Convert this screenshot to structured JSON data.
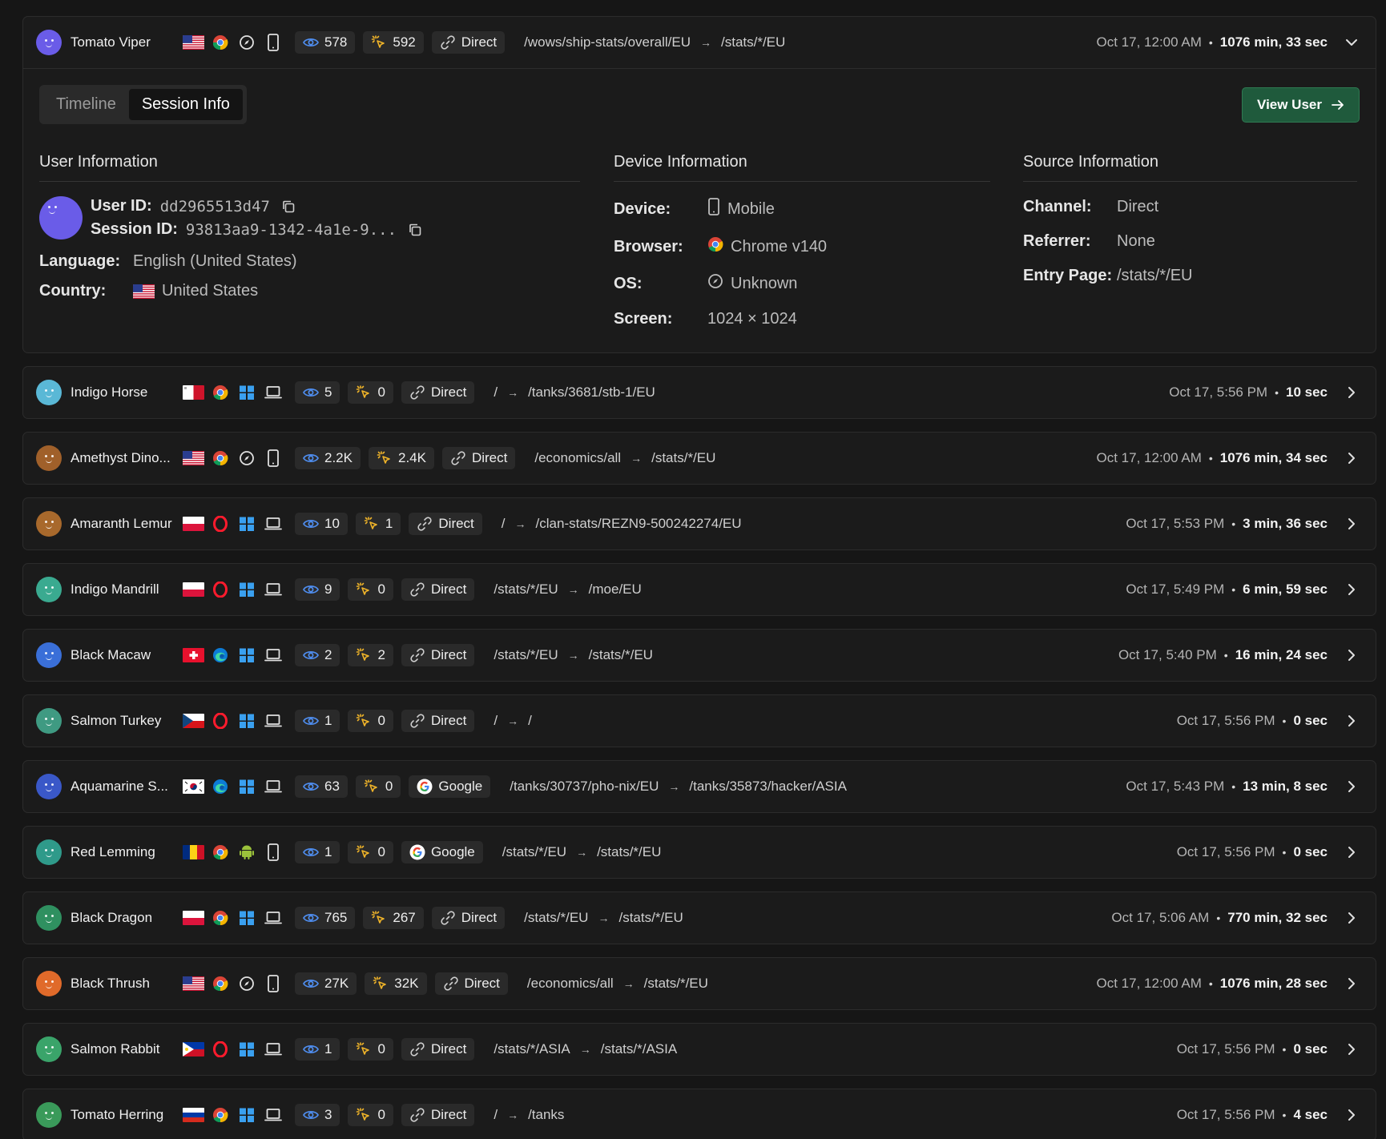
{
  "expanded_session": {
    "user_name": "Tomato Viper",
    "views": "578",
    "events": "592",
    "channel": "Direct",
    "entry_path": "/wows/ship-stats/overall/EU",
    "exit_path": "/stats/*/EU",
    "time": "Oct 17, 12:00 AM",
    "duration": "1076 min, 33 sec",
    "tabs": [
      "Timeline",
      "Session Info"
    ],
    "active_tab": "Session Info",
    "view_user_label": "View User",
    "user_info": {
      "title": "User Information",
      "user_id_label": "User ID:",
      "user_id": "dd2965513d47",
      "session_id_label": "Session ID:",
      "session_id": "93813aa9-1342-4a1e-9...",
      "language_label": "Language:",
      "language": "English (United States)",
      "country_label": "Country:",
      "country": "United States"
    },
    "device_info": {
      "title": "Device Information",
      "device_label": "Device:",
      "device": "Mobile",
      "browser_label": "Browser:",
      "browser": "Chrome v140",
      "os_label": "OS:",
      "os": "Unknown",
      "screen_label": "Screen:",
      "screen": "1024 × 1024"
    },
    "source_info": {
      "title": "Source Information",
      "channel_label": "Channel:",
      "channel": "Direct",
      "referrer_label": "Referrer:",
      "referrer": "None",
      "entry_label": "Entry Page:",
      "entry": "/stats/*/EU"
    }
  },
  "sessions": [
    {
      "name": "Indigo Horse",
      "flag": "mt",
      "browser": "chrome",
      "os": "windows",
      "device": "laptop",
      "views": "5",
      "events": "0",
      "channel": "Direct",
      "channel_icon": "link",
      "entry": "/",
      "exit": "/tanks/3681/stb-1/EU",
      "time": "Oct 17, 5:56 PM",
      "duration": "10 sec",
      "color": "#5ab8d6"
    },
    {
      "name": "Amethyst Dino...",
      "flag": "us",
      "browser": "chrome",
      "os": "unknown",
      "device": "mobile",
      "views": "2.2K",
      "events": "2.4K",
      "channel": "Direct",
      "channel_icon": "link",
      "entry": "/economics/all",
      "exit": "/stats/*/EU",
      "time": "Oct 17, 12:00 AM",
      "duration": "1076 min, 34 sec",
      "color": "#a0602a"
    },
    {
      "name": "Amaranth Lemur",
      "flag": "pl",
      "browser": "opera",
      "os": "windows",
      "device": "laptop",
      "views": "10",
      "events": "1",
      "channel": "Direct",
      "channel_icon": "link",
      "entry": "/",
      "exit": "/clan-stats/REZN9-500242274/EU",
      "time": "Oct 17, 5:53 PM",
      "duration": "3 min, 36 sec",
      "color": "#a8692c"
    },
    {
      "name": "Indigo Mandrill",
      "flag": "pl",
      "browser": "opera",
      "os": "windows",
      "device": "laptop",
      "views": "9",
      "events": "0",
      "channel": "Direct",
      "channel_icon": "link",
      "entry": "/stats/*/EU",
      "exit": "/moe/EU",
      "time": "Oct 17, 5:49 PM",
      "duration": "6 min, 59 sec",
      "color": "#3aaa90"
    },
    {
      "name": "Black Macaw",
      "flag": "ch",
      "browser": "edge",
      "os": "windows",
      "device": "laptop",
      "views": "2",
      "events": "2",
      "channel": "Direct",
      "channel_icon": "link",
      "entry": "/stats/*/EU",
      "exit": "/stats/*/EU",
      "time": "Oct 17, 5:40 PM",
      "duration": "16 min, 24 sec",
      "color": "#3a6fd8"
    },
    {
      "name": "Salmon Turkey",
      "flag": "cz",
      "browser": "opera",
      "os": "windows",
      "device": "laptop",
      "views": "1",
      "events": "0",
      "channel": "Direct",
      "channel_icon": "link",
      "entry": "/",
      "exit": "/",
      "time": "Oct 17, 5:56 PM",
      "duration": "0 sec",
      "color": "#3f9a82"
    },
    {
      "name": "Aquamarine S...",
      "flag": "kr",
      "browser": "edge",
      "os": "windows",
      "device": "laptop",
      "views": "63",
      "events": "0",
      "channel": "Google",
      "channel_icon": "google",
      "entry": "/tanks/30737/pho-nix/EU",
      "exit": "/tanks/35873/hacker/ASIA",
      "time": "Oct 17, 5:43 PM",
      "duration": "13 min, 8 sec",
      "color": "#3a58c8"
    },
    {
      "name": "Red Lemming",
      "flag": "ro",
      "browser": "chrome",
      "os": "android",
      "device": "mobile",
      "views": "1",
      "events": "0",
      "channel": "Google",
      "channel_icon": "google",
      "entry": "/stats/*/EU",
      "exit": "/stats/*/EU",
      "time": "Oct 17, 5:56 PM",
      "duration": "0 sec",
      "color": "#2f9a8a"
    },
    {
      "name": "Black Dragon",
      "flag": "pl",
      "browser": "chrome",
      "os": "windows",
      "device": "laptop",
      "views": "765",
      "events": "267",
      "channel": "Direct",
      "channel_icon": "link",
      "entry": "/stats/*/EU",
      "exit": "/stats/*/EU",
      "time": "Oct 17, 5:06 AM",
      "duration": "770 min, 32 sec",
      "color": "#2f9060"
    },
    {
      "name": "Black Thrush",
      "flag": "us",
      "browser": "chrome",
      "os": "unknown",
      "device": "mobile",
      "views": "27K",
      "events": "32K",
      "channel": "Direct",
      "channel_icon": "link",
      "entry": "/economics/all",
      "exit": "/stats/*/EU",
      "time": "Oct 17, 12:00 AM",
      "duration": "1076 min, 28 sec",
      "color": "#e06a2a"
    },
    {
      "name": "Salmon Rabbit",
      "flag": "ph",
      "browser": "opera",
      "os": "windows",
      "device": "laptop",
      "views": "1",
      "events": "0",
      "channel": "Direct",
      "channel_icon": "link",
      "entry": "/stats/*/ASIA",
      "exit": "/stats/*/ASIA",
      "time": "Oct 17, 5:56 PM",
      "duration": "0 sec",
      "color": "#3aa46a"
    },
    {
      "name": "Tomato Herring",
      "flag": "ru",
      "browser": "chrome",
      "os": "windows",
      "device": "laptop",
      "views": "3",
      "events": "0",
      "channel": "Direct",
      "channel_icon": "link",
      "entry": "/",
      "exit": "/tanks",
      "time": "Oct 17, 5:56 PM",
      "duration": "4 sec",
      "color": "#3a9a5a"
    }
  ]
}
